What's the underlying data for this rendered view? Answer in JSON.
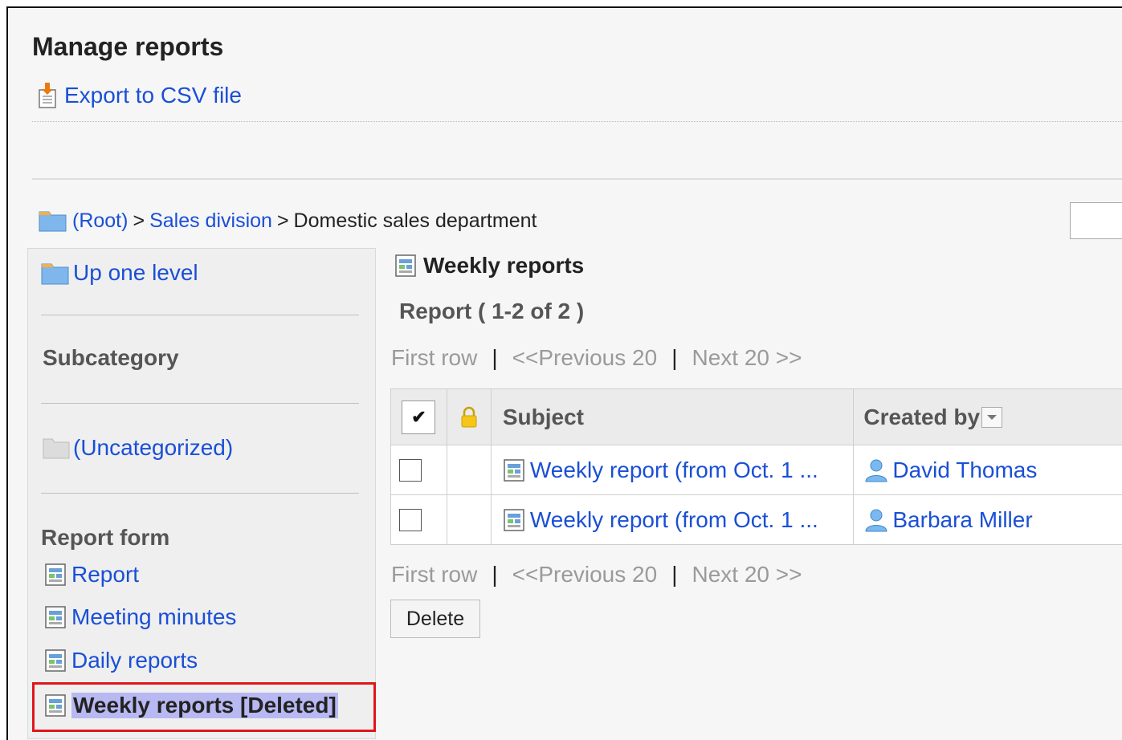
{
  "page_title": "Manage reports",
  "export_label": "Export to CSV file",
  "breadcrumb": {
    "root": "(Root)",
    "sep1": ">",
    "level1": "Sales division",
    "sep2": ">",
    "current": "Domestic sales department"
  },
  "sidebar": {
    "up_one_level": "Up one level",
    "subcategory_heading": "Subcategory",
    "uncategorized": "(Uncategorized)",
    "report_form_heading": "Report form",
    "forms": [
      "Report",
      "Meeting minutes",
      "Daily reports"
    ],
    "selected_form": "Weekly reports [Deleted]"
  },
  "content": {
    "title": "Weekly reports",
    "count_text": "Report ( 1-2 of 2 )",
    "pager": {
      "first": "First row",
      "sep": "|",
      "prev": "<<Previous 20",
      "next": "Next 20 >>"
    },
    "table": {
      "headers": {
        "check_mark": "✔",
        "subject": "Subject",
        "created_by": "Created by"
      },
      "rows": [
        {
          "subject": "Weekly report (from Oct. 1 ...",
          "created_by": "David Thomas"
        },
        {
          "subject": "Weekly report (from Oct. 1 ...",
          "created_by": "Barbara Miller"
        }
      ]
    },
    "delete_label": "Delete"
  },
  "colors": {
    "link": "#1a4fd6",
    "highlight": "#b8b8f2",
    "selection_border": "#e0161b"
  },
  "icons": [
    "export-icon",
    "folder-icon",
    "report-form-icon",
    "lock-icon",
    "user-icon",
    "sort-dropdown-icon"
  ]
}
